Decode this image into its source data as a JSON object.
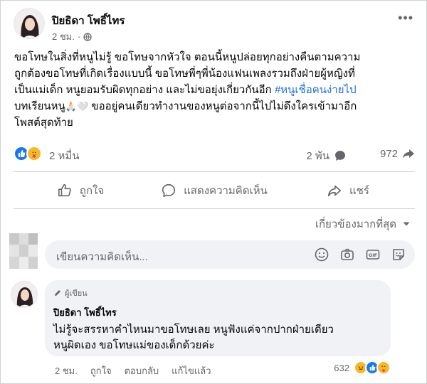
{
  "post": {
    "author": "ปิยธิดา โพธิ์ไทร",
    "time": "2 ชม.",
    "dot": "·",
    "text_lines": [
      "ขอโทษในสิ่งที่หนูไม่รู้ ขอโทษจากหัวใจ ตอนนี้หนูปล่อยทุกอย่างคืนตามความ",
      "ถูกต้องขอโทษที่เกิดเรื่องแบบนี้ ขอโทษพี่ๆพี่น้องแฟนเพลงรวมถึงฝ่ายผู้หญิงที่",
      "เป็นแม่เด็ก หนูยอมรับผิดทุกอย่าง และไม่ขอยุ่งเกี่ยวกันอีก"
    ],
    "hashtag": "#หนูเชื่อคนง่ายไป",
    "line4_start": "บทเรียนหนู",
    "line4_emojis": "🙏🏻🤍",
    "line4_end": "ขออยู่คนเดียวทำงานของหนูต่อจากนี้ไปไม่ดึงใครเข้ามาอีก",
    "line5": "โพสต์สุดท้าย"
  },
  "stats": {
    "reactions": "2 หมื่น",
    "comments": "2 พัน",
    "shares": "972"
  },
  "actions": {
    "like": "ถูกใจ",
    "comment": "แสดงความคิดเห็น",
    "share": "แชร์"
  },
  "sort_label": "เกี่ยวข้องมากที่สุด",
  "composer": {
    "placeholder": "เขียนความคิดเห็น..."
  },
  "comment": {
    "badge": "ผู้เขียน",
    "author": "ปิยธิดา โพธิ์ไทร",
    "text_line1": "ไม่รู้จะสรรหาคำไหนมาขอโทษเลย หนูฟังแค่จากปากฝ่ายเดียว",
    "text_line2": "หนูผิดเอง ขอโทษแม่ของเด็กด้วยค่ะ",
    "time": "2 ชม.",
    "like": "ถูกใจ",
    "reply": "ตอบกลับ",
    "edited": "แก้ไขแล้ว",
    "reaction_count": "632"
  },
  "colors": {
    "like_blue": "#1877f2",
    "hashtag_blue": "#216fdb",
    "secondary_text": "#65676b"
  }
}
